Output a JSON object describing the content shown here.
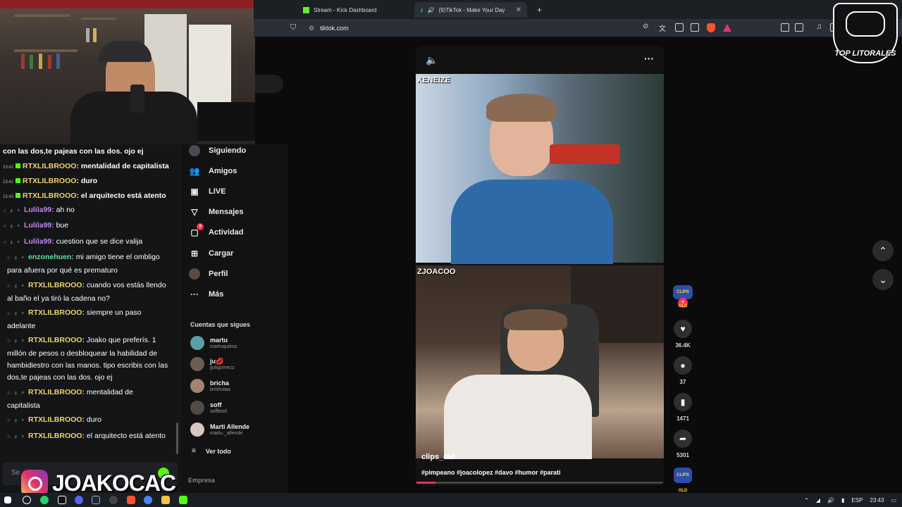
{
  "browser": {
    "tabs": [
      {
        "label": "Stream - Kick Dashboard"
      },
      {
        "label": "(9)TikTok - Make Your Day"
      }
    ],
    "url": "tiktok.com"
  },
  "chat": {
    "top_line": "con las dos,te pajeas con las dos. ojo ej",
    "messages": [
      {
        "time": "23:42",
        "user": "RTXLILBROOO",
        "text": ": mentalidad de capitalista",
        "style": "compact"
      },
      {
        "time": "23:42",
        "user": "RTXLILBROOO",
        "text": ": duro",
        "style": "compact"
      },
      {
        "time": "23:43",
        "user": "RTXLILBROOO",
        "text": ": el arquitecto está atento",
        "style": "compact"
      },
      {
        "user": "Lulila99:",
        "text": "ah no"
      },
      {
        "user": "Lulila99:",
        "text": "bue"
      },
      {
        "user": "Lulila99:",
        "text": "cuestion que se dice valija"
      },
      {
        "user": "enzonehuen:",
        "text": "mi amigo tiene el ombligo para afuera por qué es prematuro"
      },
      {
        "user": "RTXLILBROOO:",
        "text": "cuando vos estás llendo al baño el ya tiró la cadena no?"
      },
      {
        "user": "RTXLILBROOO:",
        "text": "siempre un paso adelante"
      },
      {
        "user": "RTXLILBROOO:",
        "text": "Joako que preferís. 1 millón de pesos o desbloquear la habilidad de hambidiestro con las manos. tipo escribis con las dos,te pajeas con las dos. ojo ej"
      },
      {
        "user": "RTXLILBROOO:",
        "text": "mentalidad de capitalista"
      },
      {
        "user": "RTXLILBROOO:",
        "text": "duro"
      },
      {
        "user": "RTXLILBROOO:",
        "text": "el arquitecto está atento"
      }
    ],
    "input_placeholder": "Se"
  },
  "overlay": {
    "instagram_handle": "JOAKOCAC",
    "logo_text": "TOP LITORALES"
  },
  "sidebar": {
    "nav": [
      {
        "label": "Siguiendo",
        "icon": "following-icon"
      },
      {
        "label": "Amigos",
        "icon": "friends-icon"
      },
      {
        "label": "LIVE",
        "icon": "live-icon"
      },
      {
        "label": "Mensajes",
        "icon": "messages-icon"
      },
      {
        "label": "Actividad",
        "icon": "activity-icon",
        "badge": "9"
      },
      {
        "label": "Cargar",
        "icon": "upload-icon"
      },
      {
        "label": "Perfil",
        "icon": "profile-icon"
      },
      {
        "label": "Más",
        "icon": "more-icon"
      }
    ],
    "following_title": "Cuentas que sigues",
    "accounts": [
      {
        "name": "martu",
        "handle": "martuquiiroz"
      },
      {
        "name": "ju💋",
        "handle": "jjuligomezz"
      },
      {
        "name": "bricha",
        "handle": "brishutaa"
      },
      {
        "name": "soff",
        "handle": "sofftesti"
      },
      {
        "name": "Marti Allende",
        "handle": "martu._allende"
      }
    ],
    "see_all": "Ver todo",
    "footer": "Empresa"
  },
  "video": {
    "top_cam_label": "XENEIZE",
    "bottom_cam_label": "ZJOACOO",
    "author": "clips_old",
    "hashtags": "#pimpeano #joacolopez #davo #humor #parati",
    "progress": 0.08
  },
  "actions": {
    "likes": "36.4K",
    "comments": "37",
    "saves": "1471",
    "shares": "5301",
    "channel_badge": "CLIPS OLD"
  },
  "taskbar": {
    "lang": "ESP",
    "time": "23:43"
  }
}
